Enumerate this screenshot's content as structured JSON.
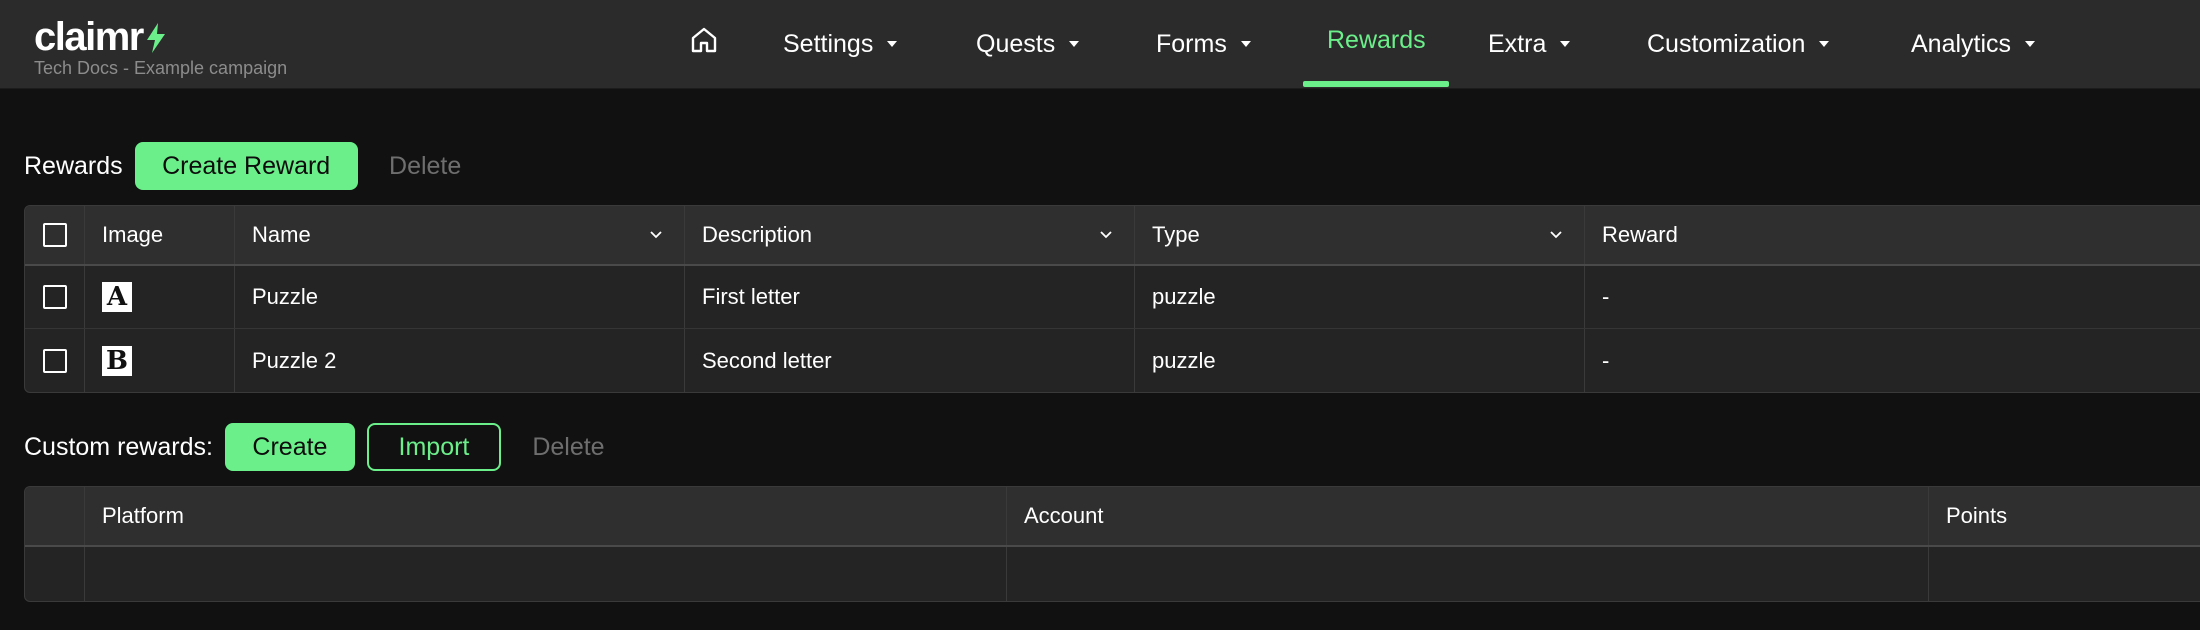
{
  "brand": {
    "logo": "claimr",
    "campaign": "Tech Docs - Example campaign",
    "accent": "#6bef8a"
  },
  "nav": {
    "home_icon": "home-icon",
    "items": [
      {
        "label": "Settings",
        "dropdown": true
      },
      {
        "label": "Quests",
        "dropdown": true
      },
      {
        "label": "Forms",
        "dropdown": true
      },
      {
        "label": "Rewards",
        "dropdown": false,
        "active": true
      },
      {
        "label": "Extra",
        "dropdown": true
      },
      {
        "label": "Customization",
        "dropdown": true
      },
      {
        "label": "Analytics",
        "dropdown": true
      }
    ]
  },
  "rewards": {
    "label": "Rewards",
    "create_label": "Create Reward",
    "delete_label": "Delete",
    "columns": [
      "Image",
      "Name",
      "Description",
      "Type",
      "Reward"
    ],
    "rows": [
      {
        "image_letter": "A",
        "name": "Puzzle",
        "description": "First letter",
        "type": "puzzle",
        "reward": "-"
      },
      {
        "image_letter": "B",
        "name": "Puzzle 2",
        "description": "Second letter",
        "type": "puzzle",
        "reward": "-"
      }
    ]
  },
  "custom_rewards": {
    "label": "Custom rewards:",
    "create_label": "Create",
    "import_label": "Import",
    "delete_label": "Delete",
    "columns": [
      "Platform",
      "Account",
      "Points"
    ],
    "rows": [
      {
        "platform": "",
        "account": "",
        "points": ""
      }
    ]
  }
}
